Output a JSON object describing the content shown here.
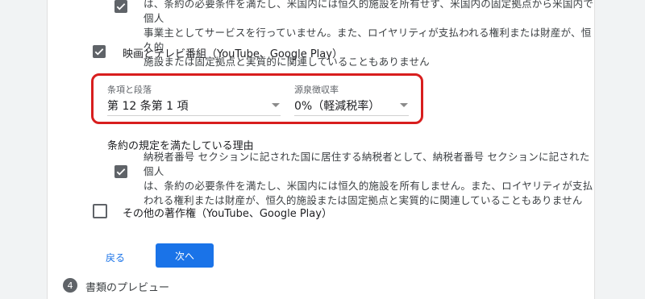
{
  "section1": {
    "para_lines": [
      "は、条約の必要条件を満たし、米国内には恒久的施設を所有せず、米国内の固定拠点から米国内で個人",
      "事業主としてサービスを行っていません。また、ロイヤリティが支払われる権利または財産が、恒久的",
      "施設または固定拠点と実質的に関連していることもありません"
    ],
    "checked": true
  },
  "movies_tv": {
    "label": "映画とテレビ番組（YouTube、Google Play）",
    "checked": true
  },
  "treaty": {
    "article_label": "条項と段落",
    "article_value": "第 12 条第 1 項",
    "rate_label": "源泉徴収率",
    "rate_value": "0%（軽減税率）"
  },
  "reason": {
    "title": "条約の規定を満たしている理由",
    "para_lines": [
      "納税者番号 セクションに記された国に居住する納税者として、納税者番号 セクションに記された個人",
      "は、条約の必要条件を満たし、米国内には恒久的施設を所有しません。また、ロイヤリティが支払",
      "われる権利または財産が、恒久的施設または固定拠点と実質的に関連していることもありません"
    ],
    "checked": true
  },
  "other_copyright": {
    "label": "その他の著作権（YouTube、Google Play）",
    "checked": false
  },
  "buttons": {
    "back": "戻る",
    "next": "次へ"
  },
  "step4": {
    "number": "4",
    "title": "書類のプレビュー"
  },
  "colors": {
    "accent": "#1a73e8",
    "highlight": "#d81e1e",
    "checkbox": "#5f6368"
  }
}
